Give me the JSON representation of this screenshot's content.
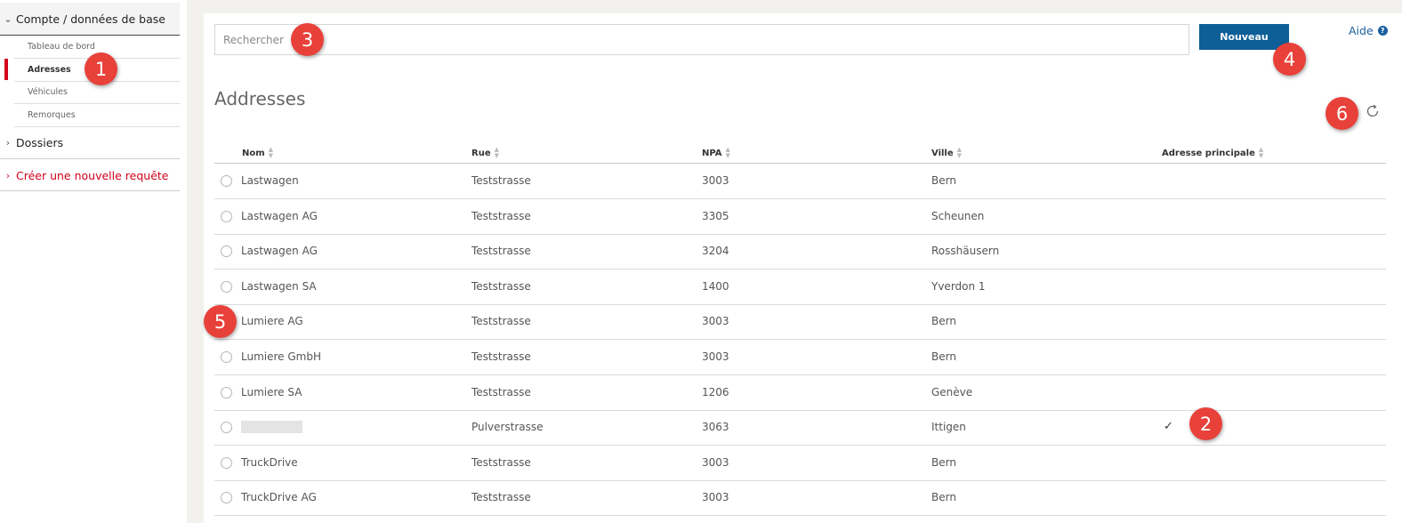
{
  "sidebar": {
    "section_account": "Compte / données de base",
    "items": [
      {
        "label": "Tableau de bord"
      },
      {
        "label": "Adresses"
      },
      {
        "label": "Véhicules"
      },
      {
        "label": "Remorques"
      }
    ],
    "section_dossiers": "Dossiers",
    "create_request": "Créer une nouvelle requête"
  },
  "toolbar": {
    "search_placeholder": "Rechercher",
    "new_button": "Nouveau",
    "help_link": "Aide",
    "help_icon_glyph": "?"
  },
  "page": {
    "title": "Addresses"
  },
  "table": {
    "columns": [
      "Nom",
      "Rue",
      "NPA",
      "Ville",
      "Adresse principale"
    ],
    "rows": [
      {
        "nom": "Lastwagen",
        "rue": "Teststrasse",
        "npa": "3003",
        "ville": "Bern",
        "principale": ""
      },
      {
        "nom": "Lastwagen AG",
        "rue": "Teststrasse",
        "npa": "3305",
        "ville": "Scheunen",
        "principale": ""
      },
      {
        "nom": "Lastwagen AG",
        "rue": "Teststrasse",
        "npa": "3204",
        "ville": "Rosshäusern",
        "principale": ""
      },
      {
        "nom": "Lastwagen SA",
        "rue": "Teststrasse",
        "npa": "1400",
        "ville": "Yverdon 1",
        "principale": ""
      },
      {
        "nom": "Lumiere AG",
        "rue": "Teststrasse",
        "npa": "3003",
        "ville": "Bern",
        "principale": ""
      },
      {
        "nom": "Lumiere GmbH",
        "rue": "Teststrasse",
        "npa": "3003",
        "ville": "Bern",
        "principale": ""
      },
      {
        "nom": "Lumiere SA",
        "rue": "Teststrasse",
        "npa": "1206",
        "ville": "Genève",
        "principale": ""
      },
      {
        "nom": "",
        "rue": "Pulverstrasse",
        "npa": "3063",
        "ville": "Ittigen",
        "principale": "✓"
      },
      {
        "nom": "TruckDrive",
        "rue": "Teststrasse",
        "npa": "3003",
        "ville": "Bern",
        "principale": ""
      },
      {
        "nom": "TruckDrive AG",
        "rue": "Teststrasse",
        "npa": "3003",
        "ville": "Bern",
        "principale": ""
      }
    ]
  },
  "callouts": [
    "1",
    "2",
    "3",
    "4",
    "5",
    "6"
  ],
  "colors": {
    "accent_red": "#d0021b",
    "primary_blue": "#0e5e98",
    "link_blue": "#1a5f9e",
    "callout_red": "#e8413a"
  }
}
